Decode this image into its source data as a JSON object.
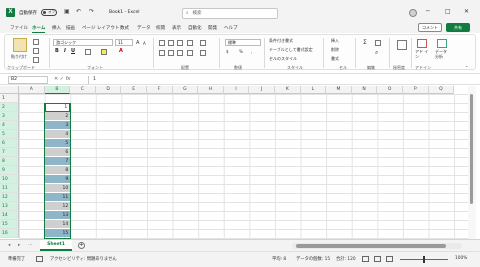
{
  "titlebar": {
    "app_letter": "X",
    "autosave_label": "自動保存",
    "autosave_state": "オフ",
    "file_title": "Book1 - Excel",
    "search_placeholder": "検索",
    "undo_icon": "↶",
    "redo_icon": "↷",
    "save_icon": "▣",
    "minimize": "─",
    "maximize": "□",
    "close": "✕"
  },
  "menu": {
    "tabs": [
      "ファイル",
      "ホーム",
      "挿入",
      "描画",
      "ページ レイアウト",
      "数式",
      "データ",
      "校閲",
      "表示",
      "自動化",
      "開発",
      "ヘルプ"
    ],
    "active_index": 1,
    "comment_label": "コメント",
    "share_label": "共有"
  },
  "ribbon": {
    "paste_label": "貼り付け",
    "clipboard_group": "クリップボード",
    "font_name": "游ゴシック",
    "font_size": "11",
    "font_group": "フォント",
    "align_group": "配置",
    "number_format": "標準",
    "number_group": "数値",
    "conditional_format": "条件付き書式",
    "format_as_table": "テーブルとして書式設定",
    "cell_styles": "セルのスタイル",
    "styles_group": "スタイル",
    "insert_label": "挿入",
    "delete_label": "削除",
    "format_label": "書式",
    "cells_group": "セル",
    "editing_group": "編集",
    "sensitivity_group": "秘密度",
    "addins_label": "アド イン",
    "addins_group": "アドイン",
    "data_analysis_label": "データ 分析"
  },
  "formula": {
    "namebox": "B2",
    "fx_label": "fx",
    "value": "1"
  },
  "grid": {
    "columns": [
      "A",
      "B",
      "C",
      "D",
      "E",
      "F",
      "G",
      "H",
      "I",
      "J",
      "K",
      "L",
      "M",
      "N",
      "O",
      "P",
      "Q"
    ],
    "selected_column": "B",
    "rows": [
      "1",
      "2",
      "3",
      "4",
      "5",
      "6",
      "7",
      "8",
      "9",
      "10",
      "11",
      "12",
      "13",
      "14",
      "15",
      "16"
    ],
    "b_values": [
      "1",
      "2",
      "3",
      "4",
      "5",
      "6",
      "7",
      "8",
      "9",
      "10",
      "11",
      "12",
      "13",
      "14",
      "15"
    ],
    "fill_colors": {
      "odd": "#8fb5c8",
      "even": "#cfcfcf"
    }
  },
  "sheets": {
    "tabs": [
      "Sheet1"
    ],
    "add_icon": "+"
  },
  "status": {
    "ready": "準備完了",
    "accessibility": "アクセシビリティ: 問題ありません",
    "average": "平均: 8",
    "count": "データの個数: 15",
    "sum": "合計: 120",
    "zoom": "100%"
  }
}
